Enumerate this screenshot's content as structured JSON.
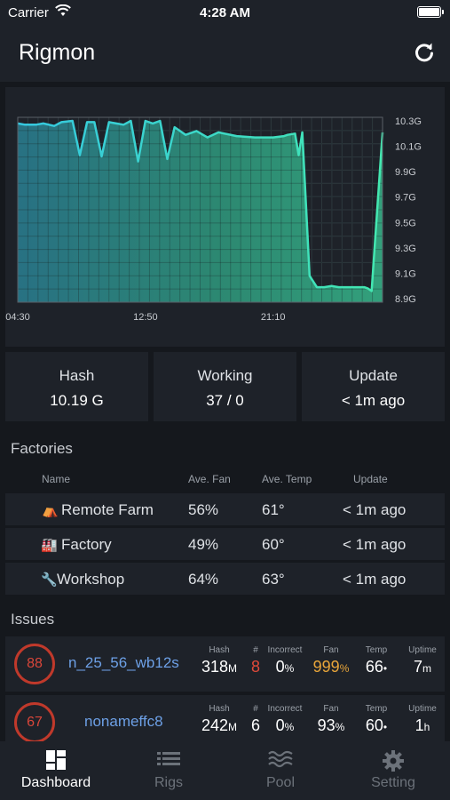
{
  "status_bar": {
    "carrier": "Carrier",
    "time": "4:28 AM"
  },
  "nav": {
    "title": "Rigmon"
  },
  "chart_data": {
    "type": "area",
    "x_tick_labels": [
      "04:30",
      "12:50",
      "21:10"
    ],
    "y_tick_labels": [
      "10.3G",
      "10.1G",
      "9.9G",
      "9.7G",
      "9.5G",
      "9.3G",
      "9.1G",
      "8.9G"
    ],
    "ylim": [
      8.9,
      10.3
    ],
    "grid": true,
    "series_color": "#3fe0b0",
    "x": [
      0,
      0.02,
      0.05,
      0.07,
      0.1,
      0.12,
      0.15,
      0.17,
      0.19,
      0.21,
      0.23,
      0.25,
      0.27,
      0.29,
      0.31,
      0.33,
      0.35,
      0.37,
      0.39,
      0.41,
      0.43,
      0.46,
      0.49,
      0.52,
      0.55,
      0.6,
      0.65,
      0.7,
      0.73,
      0.74,
      0.76,
      0.77,
      0.78,
      0.8,
      0.82,
      0.84,
      0.86,
      0.88,
      0.9,
      0.92,
      0.94,
      0.95,
      0.96,
      0.97,
      1.0
    ],
    "y": [
      10.28,
      10.27,
      10.27,
      10.28,
      10.26,
      10.29,
      10.3,
      10.03,
      10.29,
      10.29,
      10.02,
      10.29,
      10.28,
      10.27,
      10.3,
      9.98,
      10.3,
      10.28,
      10.3,
      10.0,
      10.25,
      10.19,
      10.22,
      10.17,
      10.21,
      10.18,
      10.17,
      10.17,
      10.18,
      10.19,
      10.2,
      10.03,
      10.21,
      9.08,
      8.99,
      8.99,
      9.0,
      8.99,
      8.99,
      8.99,
      8.99,
      8.99,
      8.98,
      8.96,
      10.21
    ]
  },
  "stats": [
    {
      "label": "Hash",
      "value": "10.19 G"
    },
    {
      "label": "Working",
      "value": "37 / 0"
    },
    {
      "label": "Update",
      "value": "< 1m ago"
    }
  ],
  "factories": {
    "title": "Factories",
    "headers": {
      "name": "Name",
      "fan": "Ave. Fan",
      "temp": "Ave. Temp",
      "update": "Update"
    },
    "rows": [
      {
        "icon": "⛺",
        "name": "Remote Farm",
        "fan": "56%",
        "temp": "61°",
        "update": "< 1m ago"
      },
      {
        "icon": "🏭",
        "name": "Factory",
        "fan": "49%",
        "temp": "60°",
        "update": "< 1m ago"
      },
      {
        "icon": "🔧",
        "name": "Workshop",
        "fan": "64%",
        "temp": "63°",
        "update": "< 1m ago"
      }
    ]
  },
  "issues": {
    "title": "Issues",
    "labels": {
      "hash": "Hash",
      "count": "#",
      "incorrect": "Incorrect",
      "fan": "Fan",
      "temp": "Temp",
      "uptime": "Uptime"
    },
    "rows": [
      {
        "score": "88",
        "name": "n_25_56_wb12s",
        "hash": "318",
        "hash_unit": "M",
        "count": "8",
        "incorrect": "0",
        "incorrect_unit": "%",
        "fan": "999",
        "fan_unit": "%",
        "temp": "66",
        "temp_unit": "•",
        "uptime": "7",
        "uptime_unit": "m"
      },
      {
        "score": "67",
        "name": "nonameffc8",
        "hash": "242",
        "hash_unit": "M",
        "count": "6",
        "incorrect": "0",
        "incorrect_unit": "%",
        "fan": "93",
        "fan_unit": "%",
        "temp": "60",
        "temp_unit": "•",
        "uptime": "1",
        "uptime_unit": "h"
      }
    ]
  },
  "tabs": [
    {
      "label": "Dashboard",
      "icon": "dashboard-icon",
      "active": true
    },
    {
      "label": "Rigs",
      "icon": "list-icon",
      "active": false
    },
    {
      "label": "Pool",
      "icon": "waves-icon",
      "active": false
    },
    {
      "label": "Setting",
      "icon": "gear-icon",
      "active": false
    }
  ]
}
